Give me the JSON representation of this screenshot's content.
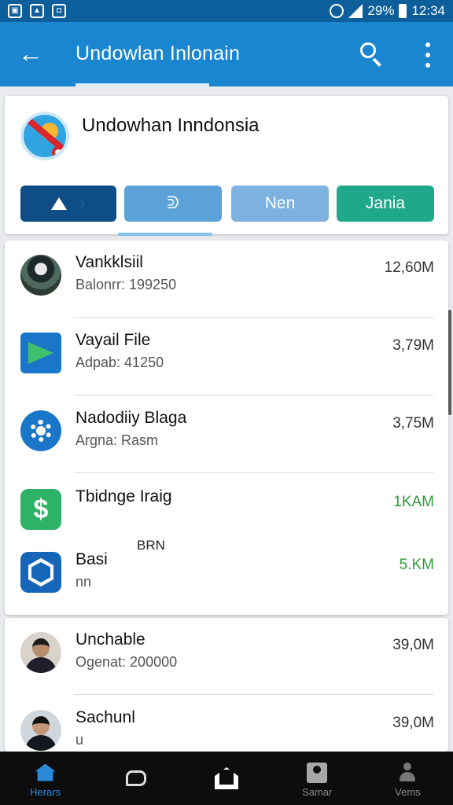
{
  "status_bar": {
    "battery": "29%",
    "time": "12:34"
  },
  "app_bar": {
    "title": "Undowlan Inlonain"
  },
  "header": {
    "title": "Undowhan Inndonsia",
    "buttons": [
      {
        "label": ""
      },
      {
        "label": "ᕲ"
      },
      {
        "label": "Nen"
      },
      {
        "label": "Jania"
      }
    ],
    "colors": {
      "btn1": "#0f4d86",
      "btn2": "#5aa2d8",
      "btn3": "#7cb1e0",
      "btn4": "#1fa88a"
    }
  },
  "list": [
    {
      "name": "Vankklsiil",
      "sub": "Balonrr: 199250",
      "size": "12,60M",
      "icon": "photo-avatar-icon"
    },
    {
      "name": "Vayail File",
      "sub": "Adpab: 41250",
      "size": "3,79M",
      "icon": "mail-icon"
    },
    {
      "name": "Nadodiiy Blaga",
      "sub": "Argna: Rasm",
      "size": "3,75M",
      "icon": "gear-icon"
    },
    {
      "name": "Tbidnge Iraig",
      "sub": "",
      "size": "1KAM",
      "icon": "money-icon"
    },
    {
      "name": "Basi",
      "sub": "nn",
      "size": "5.KM",
      "extra": "BRN",
      "icon": "badge-icon"
    }
  ],
  "list2": [
    {
      "name": "Unchable",
      "sub": "Ogenat: 200000",
      "size": "39,0M",
      "icon": "person-avatar-icon"
    },
    {
      "name": "Sachunl",
      "sub": "u",
      "size": "39,0M",
      "icon": "person-avatar-icon"
    }
  ],
  "nav": [
    {
      "label": "Herars",
      "icon": "home-icon"
    },
    {
      "label": "",
      "icon": "chat-icon"
    },
    {
      "label": "",
      "icon": "home-outline-icon"
    },
    {
      "label": "Samar",
      "icon": "contact-card-icon"
    },
    {
      "label": "Vems",
      "icon": "person-icon"
    }
  ],
  "accent": "#1a86d0",
  "green_size_color": "#2e9c3a"
}
